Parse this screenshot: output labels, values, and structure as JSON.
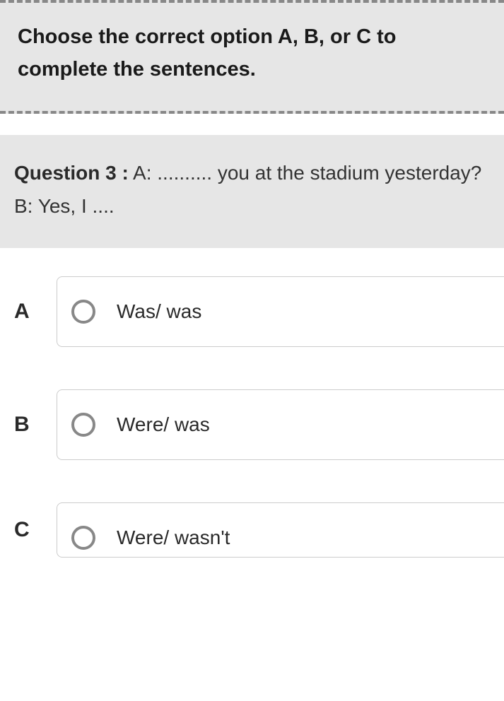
{
  "instructions": "Choose the correct option A, B, or C to complete the sentences.",
  "question": {
    "label": "Question 3 :",
    "text": " A: .......... you at the stadium yesterday? B: Yes, I ...."
  },
  "options": [
    {
      "letter": "A",
      "text": "Was/ was"
    },
    {
      "letter": "B",
      "text": "Were/ was"
    },
    {
      "letter": "C",
      "text": "Were/ wasn't"
    }
  ]
}
